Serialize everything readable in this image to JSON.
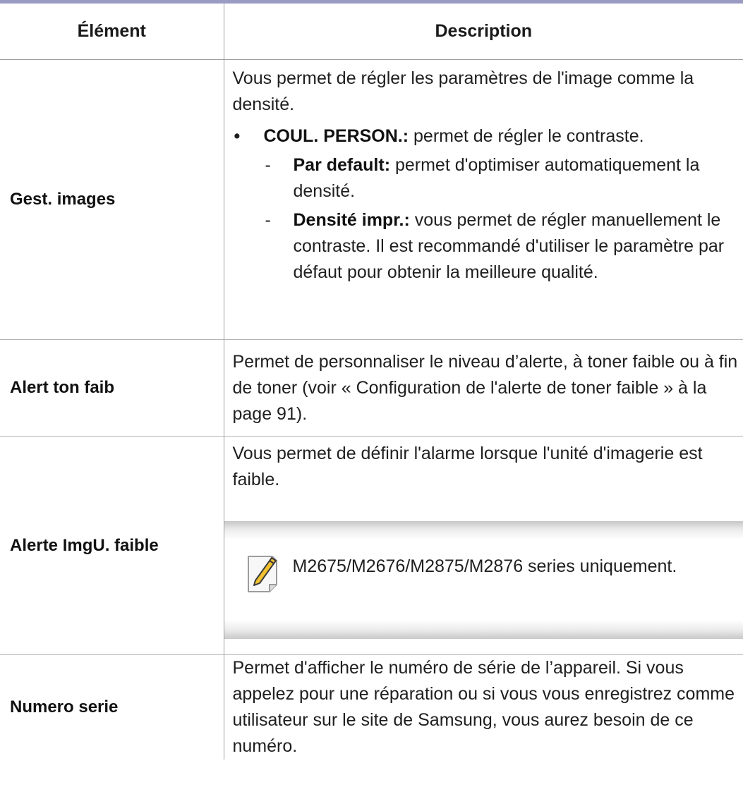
{
  "table": {
    "headers": [
      "Élément",
      "Description"
    ],
    "rows": [
      {
        "item": "Gest. images",
        "intro": "Vous permet de régler les paramètres de l'image comme la densité.",
        "bullet": {
          "term": "COUL. PERSON.:",
          "text": " permet de régler le contraste."
        },
        "subs": [
          {
            "term": "Par default:",
            "text": " permet d'optimiser automatiquement la densité."
          },
          {
            "term": "Densité impr.:",
            "text": " vous permet de régler manuellement le contraste. Il est recommandé d'utiliser le paramètre par défaut pour obtenir la meilleure qualité."
          }
        ]
      },
      {
        "item": "Alert ton faib",
        "text": "Permet de personnaliser le niveau d’alerte, à toner faible ou à fin de toner (voir « Configuration de l'alerte de toner faible » à la page 91)."
      },
      {
        "item": "Alerte ImgU. faible",
        "text": "Vous permet de définir l'alarme lorsque l'unité d'imagerie est faible.",
        "note": {
          "icon": "note-pencil-icon",
          "text": "M2675/M2676/M2875/M2876 series uniquement."
        }
      },
      {
        "item": "Numero serie",
        "text": "Permet d'afficher le numéro de série de l’appareil. Si vous appelez pour une réparation ou si vous vous enregistrez comme utilisateur sur le site de Samsung, vous aurez besoin de ce numéro."
      }
    ]
  },
  "colors": {
    "header_rule": "#9a9ac3",
    "borders": "#9c9c9c",
    "note_icon_accent": "#f2c12e"
  }
}
